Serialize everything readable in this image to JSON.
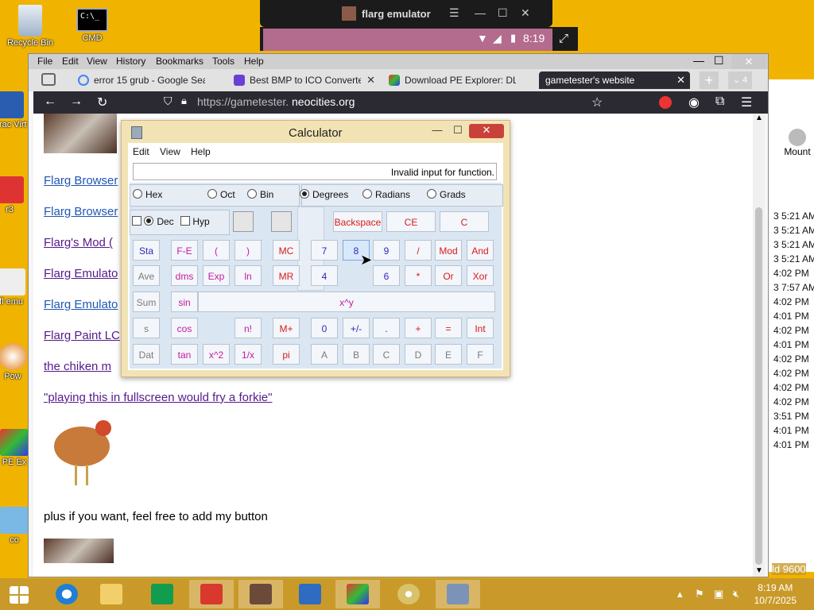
{
  "desktop": {
    "icons": [
      {
        "label": "Recycle Bin",
        "icon": "recycle-bin-icon"
      },
      {
        "label": "CMD",
        "icon": "cmd-icon",
        "glyph": "C:\\_"
      },
      {
        "label": "Orac Virt",
        "icon": "virtualbox-icon"
      },
      {
        "label": "r3",
        "icon": "app-icon"
      },
      {
        "label": "fl emu",
        "icon": "flarg-emulator-icon"
      },
      {
        "label": "Pow",
        "icon": "power-icon"
      },
      {
        "label": "PE Ex",
        "icon": "pe-explorer-icon"
      },
      {
        "label": "co",
        "icon": "computer-icon"
      }
    ]
  },
  "emulator": {
    "title": "flarg emulator",
    "time": "8:19",
    "icons": [
      "menu-icon",
      "minimize-icon",
      "maximize-icon",
      "close-icon",
      "wifi-icon",
      "signal-icon",
      "battery-icon",
      "fullscreen-icon"
    ]
  },
  "browser": {
    "menu": [
      "File",
      "Edit",
      "View",
      "History",
      "Bookmarks",
      "Tools",
      "Help"
    ],
    "tabs": [
      {
        "label": "error 15 grub - Google Sea",
        "color": "#4285f4"
      },
      {
        "label": "Best BMP to ICO Converte",
        "color": "#6b3fd4"
      },
      {
        "label": "Download PE Explorer: DLl",
        "color": "#e66a1a"
      },
      {
        "label": "gametester's website",
        "active": true
      }
    ],
    "tab_count": "4",
    "url_prefix": "https://gametester.",
    "url_host": "neocities.org",
    "page": {
      "links": [
        {
          "text": "Flarg Browser",
          "visited": false
        },
        {
          "text": "Flarg Browser",
          "visited": false
        },
        {
          "text": "Flarg's Mod (",
          "visited": true
        },
        {
          "text": "Flarg Emulato",
          "visited": true
        },
        {
          "text": "Flarg Emulato",
          "visited": false
        },
        {
          "text": "Flarg Paint LC",
          "visited": true
        },
        {
          "text": "the chiken m",
          "visited": true
        },
        {
          "text": "\"playing this in fullscreen would fry a forkie\"",
          "visited": true
        }
      ],
      "footer_text": "plus if you want, feel free to add my button"
    }
  },
  "calculator": {
    "title": "Calculator",
    "menu": [
      "Edit",
      "View",
      "Help"
    ],
    "display": "Invalid input for function.",
    "number_modes": [
      {
        "label": "Hex",
        "on": false
      },
      {
        "label": "Oct",
        "on": false
      },
      {
        "label": "Bin",
        "on": false
      }
    ],
    "angle_modes": [
      {
        "label": "Degrees",
        "on": true
      },
      {
        "label": "Radians",
        "on": false
      },
      {
        "label": "Grads",
        "on": false
      }
    ],
    "dec_label": "Dec",
    "hyp_label": "Hyp",
    "top_buttons": [
      "Backspace",
      "CE",
      "C"
    ],
    "rows": [
      [
        "Sta",
        "F-E",
        "(",
        ")",
        "MC",
        "7",
        "8",
        "9",
        "/",
        "Mod",
        "And"
      ],
      [
        "Ave",
        "dms",
        "Exp",
        "ln",
        "MR",
        "4",
        "5",
        "6",
        "*",
        "Or",
        "Xor"
      ],
      [
        "Sum",
        "sin",
        "x^y"
      ],
      [
        "s",
        "cos",
        "",
        "n!",
        "M+",
        "0",
        "+/-",
        ".",
        "+",
        "=",
        "Int"
      ],
      [
        "Dat",
        "tan",
        "x^2",
        "1/x",
        "pi",
        "A",
        "B",
        "C",
        "D",
        "E",
        "F"
      ]
    ]
  },
  "right_window": {
    "button": "Mount",
    "times": [
      "3 5:21 AM",
      "3 5:21 AM",
      "3 5:21 AM",
      "3 5:21 AM",
      "4:02 PM",
      "3 7:57 AM",
      "4:02 PM",
      "4:01 PM",
      "4:02 PM",
      "4:01 PM",
      "4:02 PM",
      "4:02 PM",
      "4:02 PM",
      "4:02 PM",
      "3:51 PM",
      "4:01 PM",
      "4:01 PM"
    ],
    "footer": "ld 9600"
  },
  "taskbar": {
    "items": [
      "start-icon",
      "ie-icon",
      "explorer-icon",
      "store-icon",
      "app-red-icon",
      "app-cat-icon",
      "virtualbox-icon",
      "pe-explorer-icon",
      "disc-icon",
      "calculator-icon"
    ],
    "time": "8:19 AM",
    "date": "10/7/2025"
  }
}
